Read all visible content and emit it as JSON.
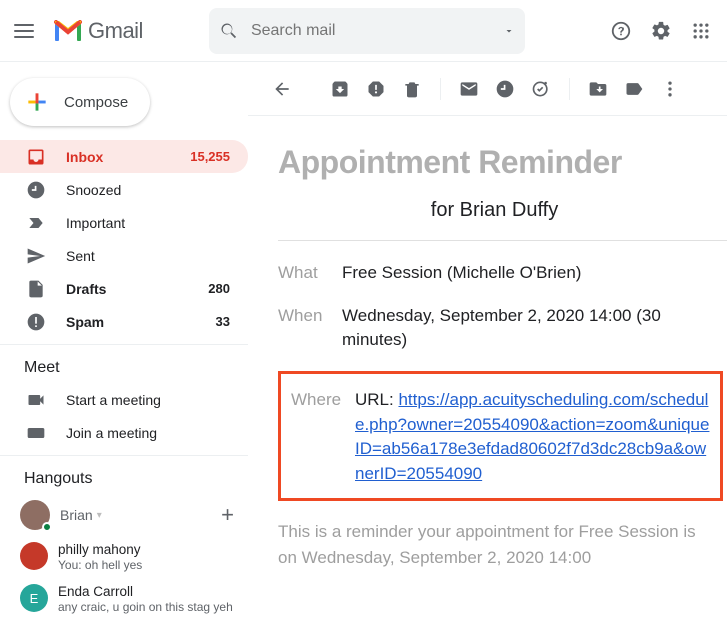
{
  "header": {
    "brand": "Gmail",
    "search_placeholder": "Search mail"
  },
  "compose_label": "Compose",
  "nav": {
    "inbox": {
      "label": "Inbox",
      "count": "15,255"
    },
    "snoozed": {
      "label": "Snoozed"
    },
    "important": {
      "label": "Important"
    },
    "sent": {
      "label": "Sent"
    },
    "drafts": {
      "label": "Drafts",
      "count": "280"
    },
    "spam": {
      "label": "Spam",
      "count": "33"
    }
  },
  "meet": {
    "title": "Meet",
    "start": "Start a meeting",
    "join": "Join a meeting"
  },
  "hangouts": {
    "title": "Hangouts",
    "user": "Brian",
    "chats": [
      {
        "name": "philly mahony",
        "msg": "You: oh hell yes",
        "color": "#c53929",
        "initial": ""
      },
      {
        "name": "Enda Carroll",
        "msg": "any craic, u goin on this stag yeh",
        "color": "#26a69a",
        "initial": "E"
      }
    ]
  },
  "email": {
    "title": "Appointment Reminder",
    "for_line": "for Brian Duffy",
    "what_label": "What",
    "what_value": "Free Session (Michelle O'Brien)",
    "when_label": "When",
    "when_value": "Wednesday, September 2, 2020 14:00 (30 minutes)",
    "where_label": "Where",
    "where_prefix": "URL: ",
    "where_url": "https://app.acuityscheduling.com/schedule.php?owner=20554090&action=zoom&uniqueID=ab56a178e3efdad80602f7d3dc28cb9a&ownerID=20554090",
    "reminder_text": "This is a reminder your appointment for Free Session is on Wednesday, September 2, 2020 14:00"
  }
}
